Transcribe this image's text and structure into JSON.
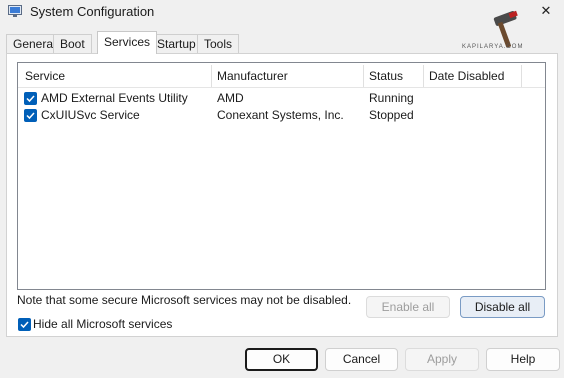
{
  "window": {
    "title": "System Configuration",
    "close_glyph": "✕",
    "watermark": "KAPILARYA.COM"
  },
  "tabs": [
    {
      "label": "General",
      "active": false
    },
    {
      "label": "Boot",
      "active": false
    },
    {
      "label": "Services",
      "active": true
    },
    {
      "label": "Startup",
      "active": false
    },
    {
      "label": "Tools",
      "active": false
    }
  ],
  "services_table": {
    "columns": [
      "Service",
      "Manufacturer",
      "Status",
      "Date Disabled"
    ],
    "rows": [
      {
        "checked": true,
        "service": "AMD External Events Utility",
        "manufacturer": "AMD",
        "status": "Running",
        "date_disabled": ""
      },
      {
        "checked": true,
        "service": "CxUIUSvc Service",
        "manufacturer": "Conexant Systems, Inc.",
        "status": "Stopped",
        "date_disabled": ""
      }
    ]
  },
  "note": "Note that some secure Microsoft services may not be disabled.",
  "buttons": {
    "enable_all": "Enable all",
    "disable_all": "Disable all",
    "ok": "OK",
    "cancel": "Cancel",
    "apply": "Apply",
    "help": "Help"
  },
  "hide_microsoft": {
    "label": "Hide all Microsoft services",
    "checked": true
  },
  "colors": {
    "accent": "#005fb8",
    "panel": "#ffffff",
    "background": "#f0f0f0"
  }
}
